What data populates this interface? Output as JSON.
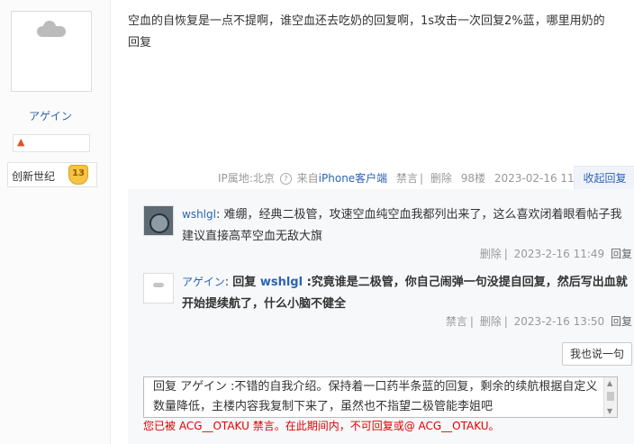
{
  "author": {
    "name": "アゲイン",
    "level_name": "创新世纪",
    "level_number": "13",
    "badge_icon": "fire-badge-icon"
  },
  "post": {
    "content_line1": "空血的自恢复是一点不提啊，谁空血还去吃奶的回复啊，1s攻击一次回复2%蓝，哪里用奶的",
    "content_line2": "回复",
    "ip_location": "IP属地:北京",
    "help_mark": "?",
    "client_prefix": "来自",
    "client_name": "iPhone客户端",
    "ban_label": "禁言",
    "separator": "|",
    "delete_label": "删除",
    "floor": "98楼",
    "timestamp": "2023-02-16 11:34",
    "collapse_reply_label": "收起回复"
  },
  "replies": [
    {
      "user": "wshlgl",
      "content": "难绷，经典二极管，攻速空血纯空血我都列出来了，这么喜欢闭着眼看帖子我建议直接高苹空血无敌大旗",
      "actions": [
        "删除"
      ],
      "separator": "|",
      "time": "2023-2-16 11:49",
      "reply_label": "回复"
    },
    {
      "user": "アゲイン",
      "reply_prefix": "回复",
      "reply_target": "wshlgl",
      "content": ":究竟谁是二极管，你自己闹弹一句没提自回复，然后写出血就开始提续航了，什么小脑不健全",
      "actions": [
        "禁言",
        "删除"
      ],
      "separator": "|",
      "time": "2023-2-16 13:50",
      "reply_label": "回复"
    }
  ],
  "say_button_label": "我也说一句",
  "editor": {
    "text": "回复 アゲイン :不错的自我介绍。保持着一口药半条蓝的回复，剩余的续航根据自定义数量降低，主楼内容我复制下来了，虽然也不指望二极管能李姐吧"
  },
  "ban_notice": "您已被 ACG__OTAKU 禁言。在此期间内，不可回复或@ ACG__OTAKU。"
}
